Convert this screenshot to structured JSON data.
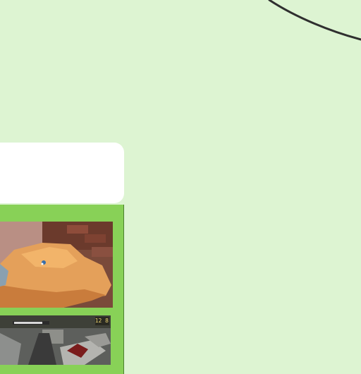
{
  "screen": {
    "background_color": "#ddf4d2",
    "arc_color": "#2f2f2f",
    "card_color": "#ffffff",
    "panel_color": "#88d157"
  },
  "panel": {
    "thumbnails": [
      {
        "name": "game-screenshot-desert-rock"
      },
      {
        "name": "game-screenshot-action-hud",
        "hud_text": "12 8"
      }
    ]
  }
}
